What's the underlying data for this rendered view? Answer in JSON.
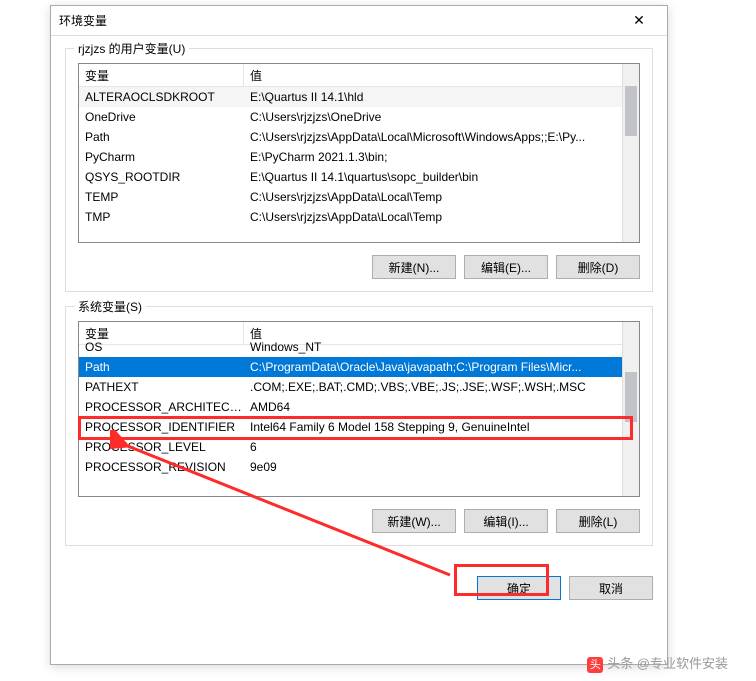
{
  "dialog": {
    "title": "环境变量",
    "close_glyph": "✕"
  },
  "user_group": {
    "label": "rjzjzs 的用户变量(U)",
    "headers": {
      "var": "变量",
      "val": "值"
    },
    "rows": [
      {
        "var": "ALTERAOCLSDKROOT",
        "val": "E:\\Quartus II 14.1\\hld"
      },
      {
        "var": "OneDrive",
        "val": "C:\\Users\\rjzjzs\\OneDrive"
      },
      {
        "var": "Path",
        "val": "C:\\Users\\rjzjzs\\AppData\\Local\\Microsoft\\WindowsApps;;E:\\Py..."
      },
      {
        "var": "PyCharm",
        "val": "E:\\PyCharm 2021.1.3\\bin;"
      },
      {
        "var": "QSYS_ROOTDIR",
        "val": "E:\\Quartus II 14.1\\quartus\\sopc_builder\\bin"
      },
      {
        "var": "TEMP",
        "val": "C:\\Users\\rjzjzs\\AppData\\Local\\Temp"
      },
      {
        "var": "TMP",
        "val": "C:\\Users\\rjzjzs\\AppData\\Local\\Temp"
      }
    ],
    "buttons": {
      "new": "新建(N)...",
      "edit": "编辑(E)...",
      "delete": "删除(D)"
    }
  },
  "sys_group": {
    "label": "系统变量(S)",
    "headers": {
      "var": "变量",
      "val": "值"
    },
    "rows": [
      {
        "var": "OS",
        "val": "Windows_NT",
        "selected": false
      },
      {
        "var": "Path",
        "val": "C:\\ProgramData\\Oracle\\Java\\javapath;C:\\Program Files\\Micr...",
        "selected": true
      },
      {
        "var": "PATHEXT",
        "val": ".COM;.EXE;.BAT;.CMD;.VBS;.VBE;.JS;.JSE;.WSF;.WSH;.MSC",
        "selected": false
      },
      {
        "var": "PROCESSOR_ARCHITECTURE",
        "val": "AMD64",
        "selected": false
      },
      {
        "var": "PROCESSOR_IDENTIFIER",
        "val": "Intel64 Family 6 Model 158 Stepping 9, GenuineIntel",
        "selected": false
      },
      {
        "var": "PROCESSOR_LEVEL",
        "val": "6",
        "selected": false
      },
      {
        "var": "PROCESSOR_REVISION",
        "val": "9e09",
        "selected": false
      }
    ],
    "buttons": {
      "new": "新建(W)...",
      "edit": "编辑(I)...",
      "delete": "删除(L)"
    }
  },
  "bottom": {
    "ok": "确定",
    "cancel": "取消"
  },
  "watermark": {
    "logo": "头",
    "text": "头条 @专业软件安装"
  }
}
